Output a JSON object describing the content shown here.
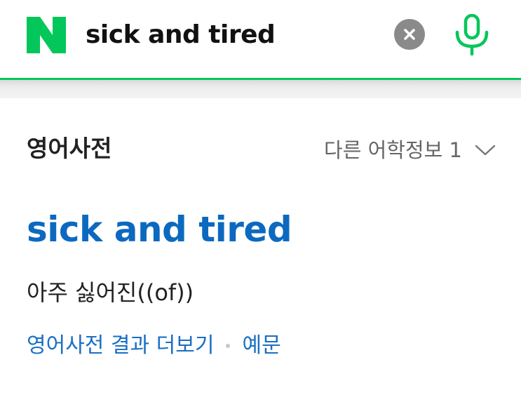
{
  "search": {
    "query": "sick and tired",
    "clear_icon": "close-icon",
    "voice_icon": "microphone-icon"
  },
  "brand": {
    "logo_letter": "N",
    "color": "#03c75a"
  },
  "dictionary": {
    "section_title": "영어사전",
    "other_info_label": "다른 어학정보 1",
    "entry": {
      "headword": "sick and tired",
      "meaning": "아주 싫어진((of))"
    },
    "links": {
      "more_results": "영어사전 결과 더보기",
      "examples": "예문"
    }
  },
  "colors": {
    "headword": "#0c69c0",
    "link": "#1a6fc4",
    "accent": "#03c75a"
  }
}
